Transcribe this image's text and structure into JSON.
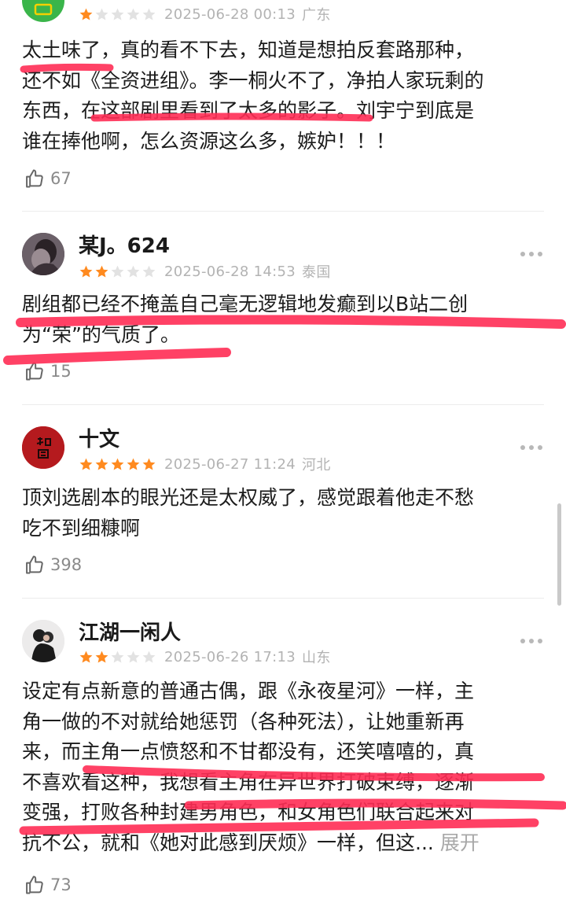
{
  "colors": {
    "star_filled": "#ff8a1f",
    "star_empty": "#e2e2e2",
    "highlight_stroke": "#ff2d55"
  },
  "reviews": [
    {
      "name": "",
      "rating": 1,
      "date": "2025-06-28 00:13",
      "location": "广东",
      "lines": [
        "太土味了，真的看不下去，知道是想拍反套路那种，",
        "还不如《全资进组》。李一桐火不了，净拍人家玩剩的",
        "东西，在这部剧里看到了太多的影子。刘宇宁到底是",
        "谁在捧他啊，怎么资源这么多，嫉妒！！！"
      ],
      "likes": "67"
    },
    {
      "name": "某J。624",
      "rating": 2,
      "date": "2025-06-28 14:53",
      "location": "泰国",
      "lines": [
        "剧组都已经不掩盖自己毫无逻辑地发癫到以B站二创",
        "为“荣”的气质了。"
      ],
      "likes": "15"
    },
    {
      "name": "十文",
      "rating": 5,
      "date": "2025-06-27 11:24",
      "location": "河北",
      "lines": [
        "顶刘选剧本的眼光还是太权威了，感觉跟着他走不愁",
        "吃不到细糠啊"
      ],
      "likes": "398"
    },
    {
      "name": "江湖一闲人",
      "rating": 2,
      "date": "2025-06-26 17:13",
      "location": "山东",
      "lines": [
        "设定有点新意的普通古偶，跟《永夜星河》一样，主",
        "角一做的不对就给她惩罚（各种死法），让她重新再",
        "来，而主角一点愤怒和不甘都没有，还笑嘻嘻的，真",
        "不喜欢看这种，我想看主角在异世界打破束缚，逐渐",
        "变强，打败各种封建男角色，和女角色们联合起来对",
        "抗不公，就和《她对此感到厌烦》一样，但这..."
      ],
      "expand_label": "展开",
      "likes": "73"
    }
  ],
  "icons": {
    "like": "thumbs-up-icon",
    "more": "more-dots-icon",
    "star": "star-icon"
  }
}
